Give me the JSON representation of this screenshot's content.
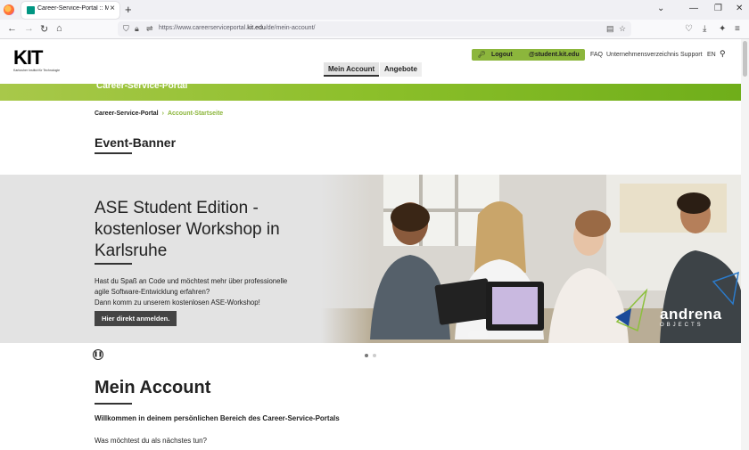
{
  "browser": {
    "tab_title": "Career-Service-Portal :: Mein A",
    "url_prefix": "https://www.careerserviceportal.",
    "url_domain": "kit.edu",
    "url_path": "/de/mein-account/"
  },
  "header": {
    "logo_word": "KIT",
    "logo_sub": "Karlsruher Institut für Technologie",
    "tabs": [
      {
        "label": "Mein Account",
        "active": true
      },
      {
        "label": "Angebote",
        "active": false
      }
    ],
    "logout_label": "Logout",
    "user_label": "@student.kit.edu",
    "links": {
      "faq": "FAQ",
      "directory": "Unternehmensverzeichnis",
      "support": "Support",
      "lang": "EN"
    },
    "accent_color": "#8cb63c"
  },
  "band": {
    "title": "Career-Service-Portal"
  },
  "breadcrumb": {
    "home": "Career-Service-Portal",
    "current": "Account-Startseite"
  },
  "event_banner": {
    "section_title": "Event-Banner",
    "heading": "ASE Student Edition - kostenloser Workshop in Karlsruhe",
    "text_lines": [
      "Hast du Spaß an Code und möchtest mehr über professionelle",
      "agile Software-Entwicklung erfahren?",
      "Dann komm zu unserem kostenlosen ASE-Workshop!"
    ],
    "cta_label": "Hier direkt anmelden.",
    "partner_logo": "andrena",
    "partner_logo_sub": "OBJECTS"
  },
  "account": {
    "title": "Mein Account",
    "welcome": "Willkommen in deinem persönlichen Bereich des Career-Service-Portals",
    "question": "Was möchtest du als nächstes tun?"
  }
}
